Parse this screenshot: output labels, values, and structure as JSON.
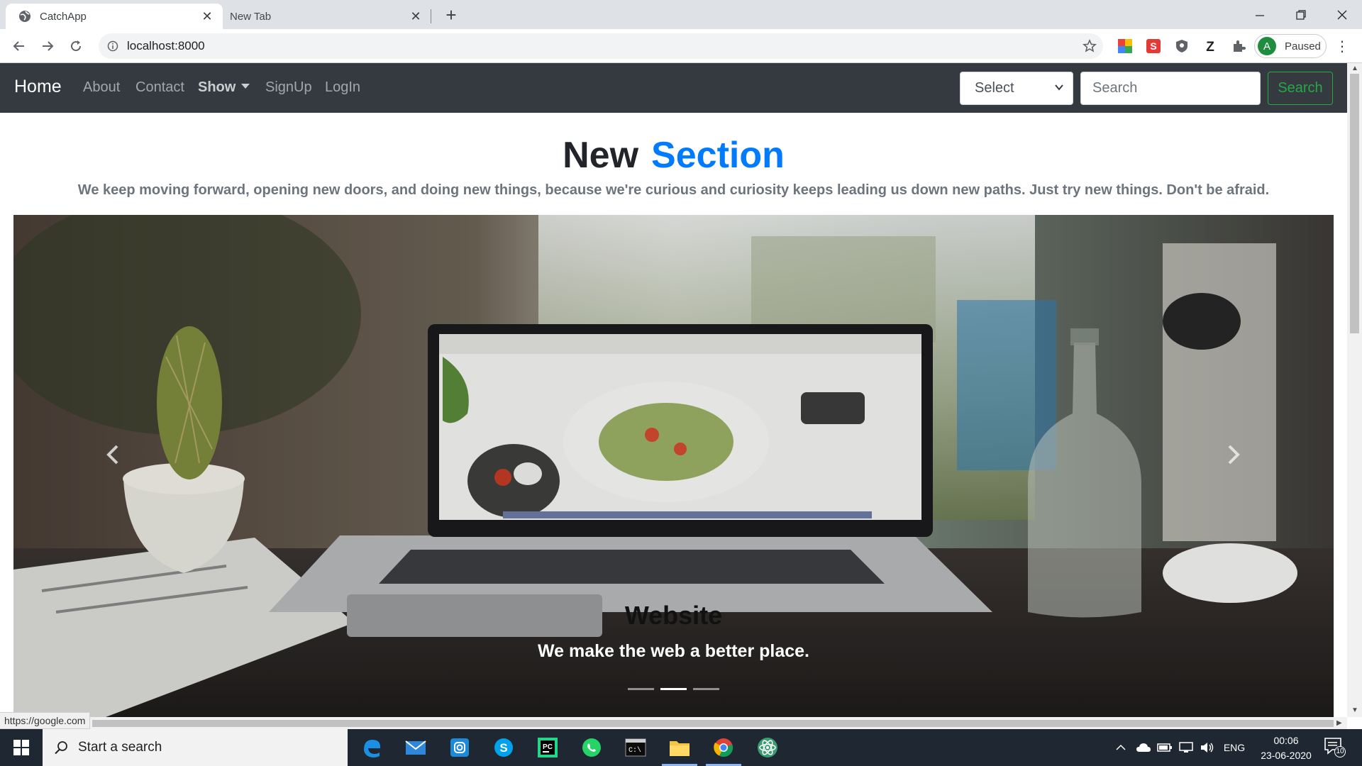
{
  "browser": {
    "tabs": [
      {
        "title": "CatchApp",
        "active": true
      },
      {
        "title": "New Tab",
        "active": false
      }
    ],
    "url": "localhost:8000",
    "profile_label": "Paused",
    "profile_initial": "A",
    "status_url": "https://google.com"
  },
  "site_nav": {
    "brand": "Home",
    "links": [
      "About",
      "Contact",
      "Show",
      "SignUp",
      "LogIn"
    ],
    "select_value": "Select",
    "search_placeholder": "Search",
    "search_button": "Search"
  },
  "hero": {
    "title_main": "New",
    "title_accent": "Section",
    "lead": "We keep moving forward, opening new doors, and doing new things, because we're curious and curiosity keeps leading us down new paths. Just try new things. Don't be afraid."
  },
  "carousel": {
    "caption_title": "Website",
    "caption_text": "We make the web a better place.",
    "indicator_count": 3,
    "active_index": 1
  },
  "taskbar": {
    "search_placeholder": "Start a search",
    "language": "ENG",
    "time": "00:06",
    "date": "23-06-2020",
    "notification_count": "10"
  },
  "colors": {
    "navbar_bg": "#343a40",
    "accent_blue": "#007bff",
    "success_green": "#28a745",
    "taskbar_bg": "#1f2733"
  }
}
